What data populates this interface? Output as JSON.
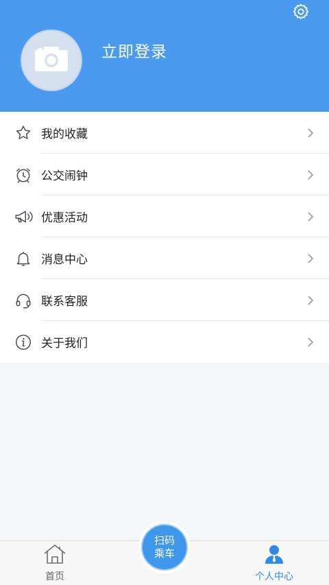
{
  "header": {
    "login_text": "立即登录",
    "background_color": "#4a9bf0"
  },
  "menu": {
    "items": [
      {
        "label": "我的收藏",
        "icon": "star-icon"
      },
      {
        "label": "公交闹钟",
        "icon": "alarm-clock-icon"
      },
      {
        "label": "优惠活动",
        "icon": "megaphone-icon"
      },
      {
        "label": "消息中心",
        "icon": "bell-icon"
      },
      {
        "label": "联系客服",
        "icon": "headset-icon"
      },
      {
        "label": "关于我们",
        "icon": "info-icon"
      }
    ]
  },
  "bottom_nav": {
    "home_label": "首页",
    "profile_label": "个人中心",
    "scan_line1": "扫码",
    "scan_line2": "乘车",
    "active_color": "#2f8be6"
  }
}
